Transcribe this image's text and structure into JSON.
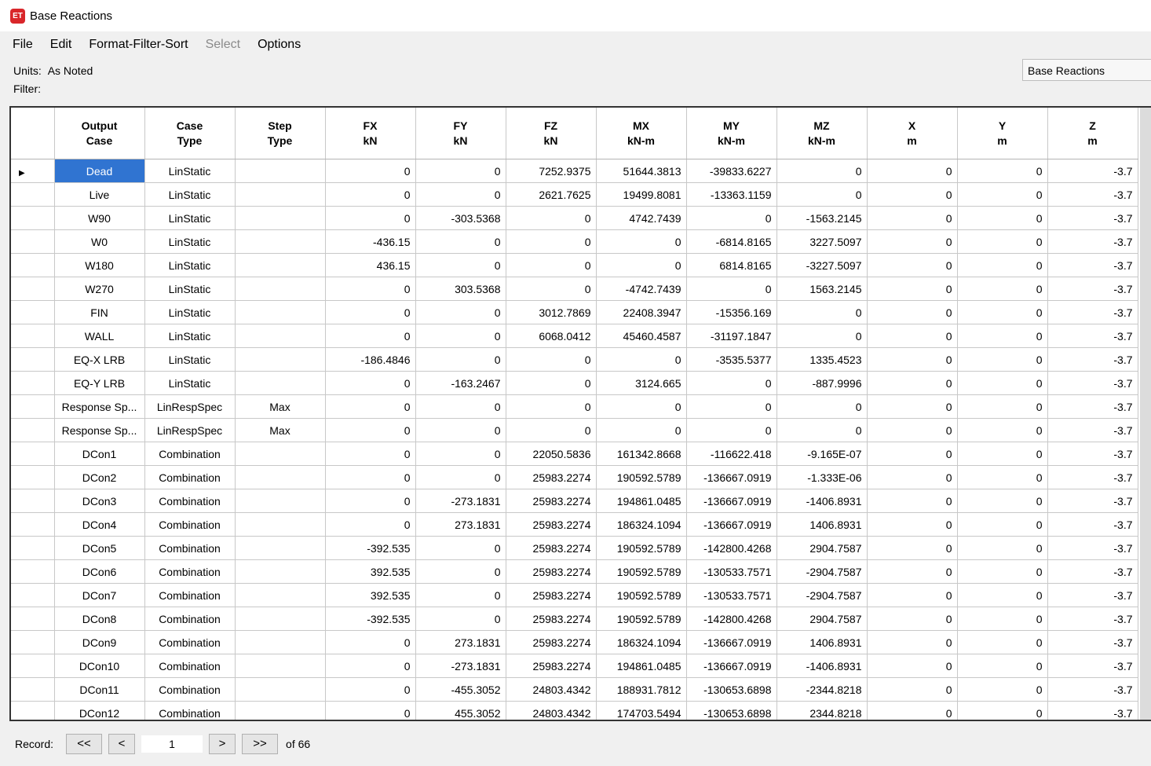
{
  "window": {
    "title": "Base Reactions",
    "icon_text": "ET"
  },
  "menu": [
    {
      "label": "File",
      "enabled": true
    },
    {
      "label": "Edit",
      "enabled": true
    },
    {
      "label": "Format-Filter-Sort",
      "enabled": true
    },
    {
      "label": "Select",
      "enabled": false
    },
    {
      "label": "Options",
      "enabled": true
    }
  ],
  "units_label": "Units:",
  "units_value": "As Noted",
  "filter_label": "Filter:",
  "table_select": "Base Reactions",
  "table": {
    "columns": [
      {
        "name": "Output",
        "unit": "Case"
      },
      {
        "name": "Case",
        "unit": "Type"
      },
      {
        "name": "Step",
        "unit": "Type"
      },
      {
        "name": "FX",
        "unit": "kN"
      },
      {
        "name": "FY",
        "unit": "kN"
      },
      {
        "name": "FZ",
        "unit": "kN"
      },
      {
        "name": "MX",
        "unit": "kN-m"
      },
      {
        "name": "MY",
        "unit": "kN-m"
      },
      {
        "name": "MZ",
        "unit": "kN-m"
      },
      {
        "name": "X",
        "unit": "m"
      },
      {
        "name": "Y",
        "unit": "m"
      },
      {
        "name": "Z",
        "unit": "m"
      }
    ],
    "rows": [
      [
        "Dead",
        "LinStatic",
        "",
        "0",
        "0",
        "7252.9375",
        "51644.3813",
        "-39833.6227",
        "0",
        "0",
        "0",
        "-3.7"
      ],
      [
        "Live",
        "LinStatic",
        "",
        "0",
        "0",
        "2621.7625",
        "19499.8081",
        "-13363.1159",
        "0",
        "0",
        "0",
        "-3.7"
      ],
      [
        "W90",
        "LinStatic",
        "",
        "0",
        "-303.5368",
        "0",
        "4742.7439",
        "0",
        "-1563.2145",
        "0",
        "0",
        "-3.7"
      ],
      [
        "W0",
        "LinStatic",
        "",
        "-436.15",
        "0",
        "0",
        "0",
        "-6814.8165",
        "3227.5097",
        "0",
        "0",
        "-3.7"
      ],
      [
        "W180",
        "LinStatic",
        "",
        "436.15",
        "0",
        "0",
        "0",
        "6814.8165",
        "-3227.5097",
        "0",
        "0",
        "-3.7"
      ],
      [
        "W270",
        "LinStatic",
        "",
        "0",
        "303.5368",
        "0",
        "-4742.7439",
        "0",
        "1563.2145",
        "0",
        "0",
        "-3.7"
      ],
      [
        "FIN",
        "LinStatic",
        "",
        "0",
        "0",
        "3012.7869",
        "22408.3947",
        "-15356.169",
        "0",
        "0",
        "0",
        "-3.7"
      ],
      [
        "WALL",
        "LinStatic",
        "",
        "0",
        "0",
        "6068.0412",
        "45460.4587",
        "-31197.1847",
        "0",
        "0",
        "0",
        "-3.7"
      ],
      [
        "EQ-X LRB",
        "LinStatic",
        "",
        "-186.4846",
        "0",
        "0",
        "0",
        "-3535.5377",
        "1335.4523",
        "0",
        "0",
        "-3.7"
      ],
      [
        "EQ-Y LRB",
        "LinStatic",
        "",
        "0",
        "-163.2467",
        "0",
        "3124.665",
        "0",
        "-887.9996",
        "0",
        "0",
        "-3.7"
      ],
      [
        "Response Sp...",
        "LinRespSpec",
        "Max",
        "0",
        "0",
        "0",
        "0",
        "0",
        "0",
        "0",
        "0",
        "-3.7"
      ],
      [
        "Response Sp...",
        "LinRespSpec",
        "Max",
        "0",
        "0",
        "0",
        "0",
        "0",
        "0",
        "0",
        "0",
        "-3.7"
      ],
      [
        "DCon1",
        "Combination",
        "",
        "0",
        "0",
        "22050.5836",
        "161342.8668",
        "-116622.418",
        "-9.165E-07",
        "0",
        "0",
        "-3.7"
      ],
      [
        "DCon2",
        "Combination",
        "",
        "0",
        "0",
        "25983.2274",
        "190592.5789",
        "-136667.0919",
        "-1.333E-06",
        "0",
        "0",
        "-3.7"
      ],
      [
        "DCon3",
        "Combination",
        "",
        "0",
        "-273.1831",
        "25983.2274",
        "194861.0485",
        "-136667.0919",
        "-1406.8931",
        "0",
        "0",
        "-3.7"
      ],
      [
        "DCon4",
        "Combination",
        "",
        "0",
        "273.1831",
        "25983.2274",
        "186324.1094",
        "-136667.0919",
        "1406.8931",
        "0",
        "0",
        "-3.7"
      ],
      [
        "DCon5",
        "Combination",
        "",
        "-392.535",
        "0",
        "25983.2274",
        "190592.5789",
        "-142800.4268",
        "2904.7587",
        "0",
        "0",
        "-3.7"
      ],
      [
        "DCon6",
        "Combination",
        "",
        "392.535",
        "0",
        "25983.2274",
        "190592.5789",
        "-130533.7571",
        "-2904.7587",
        "0",
        "0",
        "-3.7"
      ],
      [
        "DCon7",
        "Combination",
        "",
        "392.535",
        "0",
        "25983.2274",
        "190592.5789",
        "-130533.7571",
        "-2904.7587",
        "0",
        "0",
        "-3.7"
      ],
      [
        "DCon8",
        "Combination",
        "",
        "-392.535",
        "0",
        "25983.2274",
        "190592.5789",
        "-142800.4268",
        "2904.7587",
        "0",
        "0",
        "-3.7"
      ],
      [
        "DCon9",
        "Combination",
        "",
        "0",
        "273.1831",
        "25983.2274",
        "186324.1094",
        "-136667.0919",
        "1406.8931",
        "0",
        "0",
        "-3.7"
      ],
      [
        "DCon10",
        "Combination",
        "",
        "0",
        "-273.1831",
        "25983.2274",
        "194861.0485",
        "-136667.0919",
        "-1406.8931",
        "0",
        "0",
        "-3.7"
      ],
      [
        "DCon11",
        "Combination",
        "",
        "0",
        "-455.3052",
        "24803.4342",
        "188931.7812",
        "-130653.6898",
        "-2344.8218",
        "0",
        "0",
        "-3.7"
      ],
      [
        "DCon12",
        "Combination",
        "",
        "0",
        "455.3052",
        "24803.4342",
        "174703.5494",
        "-130653.6898",
        "2344.8218",
        "0",
        "0",
        "-3.7"
      ]
    ]
  },
  "record": {
    "label": "Record:",
    "first": "<<",
    "prev": "<",
    "current": "1",
    "next": ">",
    "last": ">>",
    "of_text": "of 66"
  }
}
